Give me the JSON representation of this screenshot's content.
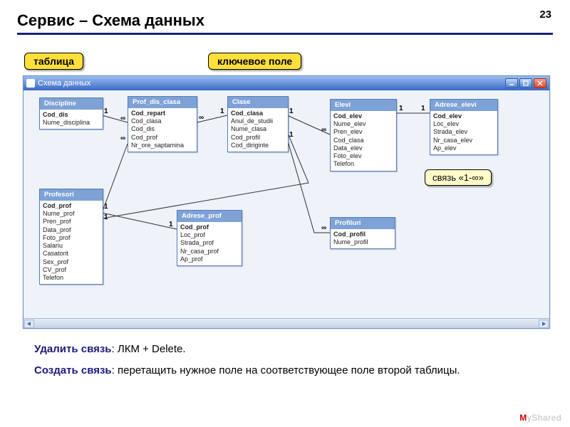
{
  "page_number": "23",
  "title": "Сервис – Схема данных",
  "callouts": {
    "table": "таблица",
    "keyfield": "ключевое поле",
    "link": "связь «1-∞»"
  },
  "window": {
    "title": "Схема данных",
    "btn_min": "minimize",
    "btn_max": "maximize",
    "btn_close": "close"
  },
  "tables": {
    "discipline": {
      "head": "Discipline",
      "key": "Cod_dis",
      "f1": "Nume_disciplina"
    },
    "pdc": {
      "head": "Prof_dis_clasa",
      "key": "Cod_repart",
      "f1": "Cod_clasa",
      "f2": "Cod_dis",
      "f3": "Cod_prof",
      "f4": "Nr_ore_saptamina"
    },
    "clase": {
      "head": "Clase",
      "key": "Cod_clasa",
      "f1": "Anul_de_studii",
      "f2": "Nume_clasa",
      "f3": "Cod_profil",
      "f4": "Cod_diriginte"
    },
    "elevi": {
      "head": "Elevi",
      "key": "Cod_elev",
      "f1": "Nume_elev",
      "f2": "Pren_elev",
      "f3": "Cod_clasa",
      "f4": "Data_elev",
      "f5": "Foto_elev",
      "f6": "Telefon"
    },
    "adrelevi": {
      "head": "Adrese_elevi",
      "key": "Cod_elev",
      "f1": "Loc_elev",
      "f2": "Strada_elev",
      "f3": "Nr_casa_elev",
      "f4": "Ap_elev"
    },
    "profesori": {
      "head": "Profesori",
      "key": "Cod_prof",
      "f1": "Nume_prof",
      "f2": "Pren_prof",
      "f3": "Data_prof",
      "f4": "Foto_prof",
      "f5": "Salariu",
      "f6": "Casatorit",
      "f7": "Sex_prof",
      "f8": "CV_prof",
      "f9": "Telefon"
    },
    "adrprof": {
      "head": "Adrese_prof",
      "key": "Cod_prof",
      "f1": "Loc_prof",
      "f2": "Strada_prof",
      "f3": "Nr_casa_prof",
      "f4": "Ap_prof"
    },
    "profiluri": {
      "head": "Profiluri",
      "key": "Cod_profil",
      "f1": "Nume_profil"
    }
  },
  "rel": {
    "one": "1",
    "many": "∞"
  },
  "footer": {
    "del_b": "Удалить связь",
    "del_r": ": ЛКМ + Delete.",
    "cr_b": "Создать связь",
    "cr_r": ": перетащить нужное поле на соответствующее поле второй таблицы."
  },
  "logo": {
    "text": "yShared",
    "m": "M"
  }
}
